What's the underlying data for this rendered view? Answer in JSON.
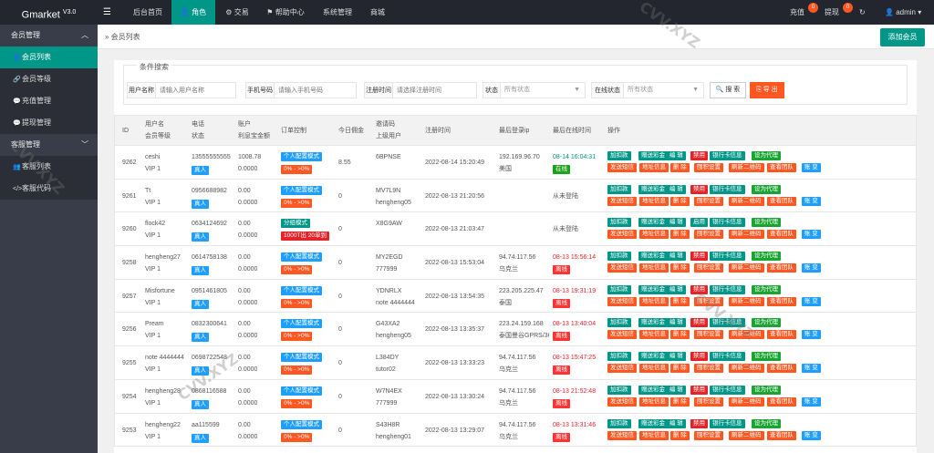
{
  "app": {
    "brand": "Gmarket",
    "version": "V3.0"
  },
  "topnav": [
    "后台首页",
    "角色",
    "交易",
    "帮助中心",
    "系统管理",
    "商城"
  ],
  "topright": {
    "recharge": "充值",
    "recharge_badge": "0",
    "withdraw": "提现",
    "withdraw_badge": "0",
    "user": "admin"
  },
  "sidebar": {
    "group1": "会员管理",
    "items1": [
      "会员列表",
      "会员等级",
      "充值管理",
      "提现管理"
    ],
    "group2": "客服管理",
    "items2": [
      "客服列表",
      "客服代码"
    ]
  },
  "crumb": "会员列表",
  "add_button": "添加会员",
  "filters": {
    "legend": "条件搜索",
    "username_label": "用户名称",
    "username_ph": "请输入用户名称",
    "phone_label": "手机号码",
    "phone_ph": "请输入手机号码",
    "regtime_label": "注册时间",
    "regtime_ph": "请选择注册时间",
    "status_label": "状态",
    "status_value": "所有状态",
    "online_label": "在线状态",
    "online_value": "所有状态",
    "search_btn": "搜 索",
    "export_btn": "导 出"
  },
  "headers": {
    "id": "ID",
    "user1": "用户名",
    "user2": "会员等级",
    "phone1": "电话",
    "phone2": "状态",
    "balance1": "账户",
    "balance2": "利息宝金额",
    "order": "订单控制",
    "today": "今日佣金",
    "invite1": "邀请码",
    "invite2": "上级用户",
    "regtime": "注册时间",
    "lastip": "最后登录ip",
    "lastonline": "最后在线时间",
    "ops": "操作"
  },
  "rows": [
    {
      "id": "9262",
      "user": "ceshi",
      "level": "VIP 1",
      "phone": "13555555555",
      "real": "真人",
      "bal": "1008.78",
      "lixi": "0.0000",
      "mode": "个人配置模式",
      "range": "0% - >0%",
      "range_color": "red",
      "today": "8.55",
      "code": "6BPNSE",
      "parent": "",
      "reg": "2022-08-14 15:20:49",
      "ip": "192.169.96.70",
      "loc": "美国",
      "last": "08-14 16:04:31",
      "last_color": "green",
      "online": "在线",
      "online_state": "on",
      "ban": "禁用"
    },
    {
      "id": "9261",
      "user": "Tt",
      "level": "VIP 1",
      "phone": "0956688982",
      "real": "真人",
      "bal": "0.00",
      "lixi": "0.0000",
      "mode": "个人配置模式",
      "range": "0% - >0%",
      "range_color": "red",
      "today": "0",
      "code": "MV7L9N",
      "parent": "hengheng05",
      "reg": "2022-08-13 21:20:56",
      "ip": "",
      "loc": "",
      "last": "从未登陆",
      "last_color": "gray",
      "online": "",
      "online_state": "",
      "ban": "禁用"
    },
    {
      "id": "9260",
      "user": "flock42",
      "level": "VIP 1",
      "phone": "0634124692",
      "real": "真人",
      "bal": "0.00",
      "lixi": "0.0000",
      "mode": "分组模式",
      "range": "1000T出 20单到",
      "range_color": "dred",
      "today": "0",
      "code": "X8G9AW",
      "parent": "",
      "reg": "2022-08-13 21:03:47",
      "ip": "",
      "loc": "",
      "last": "从未登陆",
      "last_color": "gray",
      "online": "",
      "online_state": "",
      "ban": "启用"
    },
    {
      "id": "9258",
      "user": "hengheng27",
      "level": "VIP 1",
      "phone": "0614758138",
      "real": "真人",
      "bal": "0.00",
      "lixi": "0.0000",
      "mode": "个人配置模式",
      "range": "0% - >0%",
      "range_color": "red",
      "today": "0",
      "code": "MY2EGD",
      "parent": "777999",
      "reg": "2022-08-13 15:53:04",
      "ip": "94.74.117.56",
      "loc": "乌克兰",
      "last": "08-13 15:56:14",
      "last_color": "red",
      "online": "离线",
      "online_state": "off",
      "ban": "禁用"
    },
    {
      "id": "9257",
      "user": "Misfortune",
      "level": "VIP 1",
      "phone": "0951461805",
      "real": "真人",
      "bal": "0.00",
      "lixi": "0.0000",
      "mode": "个人配置模式",
      "range": "0% - >0%",
      "range_color": "red",
      "today": "0",
      "code": "YDNRLX",
      "parent": "note 4444444",
      "reg": "2022-08-13 13:54:35",
      "ip": "223.205.225.47",
      "loc": "泰国",
      "last": "08-13 19:31:19",
      "last_color": "red",
      "online": "离线",
      "online_state": "off",
      "ban": "禁用"
    },
    {
      "id": "9256",
      "user": "Pream",
      "level": "VIP 1",
      "phone": "0832300641",
      "real": "真人",
      "bal": "0.00",
      "lixi": "0.0000",
      "mode": "个人配置模式",
      "range": "0% - >0%",
      "range_color": "red",
      "today": "0",
      "code": "G43XA2",
      "parent": "hengheng05",
      "reg": "2022-08-13 13:35:37",
      "ip": "223.24.159.168",
      "loc": "泰国曼谷GPRS/3G",
      "last": "08-13 13:40:04",
      "last_color": "red",
      "online": "离线",
      "online_state": "off",
      "ban": "禁用"
    },
    {
      "id": "9255",
      "user": "note 4444444",
      "level": "VIP 1",
      "phone": "0698722548",
      "real": "真人",
      "bal": "0.00",
      "lixi": "0.0000",
      "mode": "个人配置模式",
      "range": "0% - >0%",
      "range_color": "red",
      "today": "0",
      "code": "L384DY",
      "parent": "tutor02",
      "reg": "2022-08-13 13:33:23",
      "ip": "94.74.117.56",
      "loc": "乌克兰",
      "last": "08-13 15:47:25",
      "last_color": "red",
      "online": "离线",
      "online_state": "off",
      "ban": "禁用"
    },
    {
      "id": "9254",
      "user": "hengheng28",
      "level": "VIP 1",
      "phone": "0868116588",
      "real": "真人",
      "bal": "0.00",
      "lixi": "0.0000",
      "mode": "个人配置模式",
      "range": "0% - >0%",
      "range_color": "red",
      "today": "0",
      "code": "W7N4EX",
      "parent": "777999",
      "reg": "2022-08-13 13:30:24",
      "ip": "94.74.117.56",
      "loc": "乌克兰",
      "last": "08-13 21:52:48",
      "last_color": "red",
      "online": "离线",
      "online_state": "off",
      "ban": "禁用"
    },
    {
      "id": "9253",
      "user": "hengheng22",
      "level": "VIP 1",
      "phone": "aa115599",
      "real": "真人",
      "bal": "0.00",
      "lixi": "0.0000",
      "mode": "个人配置模式",
      "range": "0% - >0%",
      "range_color": "red",
      "today": "0",
      "code": "S43H8R",
      "parent": "hengheng01",
      "reg": "2022-08-13 13:29:07",
      "ip": "94.74.117.56",
      "loc": "乌克兰",
      "last": "08-13 13:31:46",
      "last_color": "red",
      "online": "离线",
      "online_state": "off",
      "ban": "禁用"
    }
  ],
  "ops": {
    "addsub": "加扣款",
    "gift": "赠送彩金",
    "edit": "编 辑",
    "bank": "银行卡信息",
    "setagent": "设为代理",
    "sms": "发送短信",
    "address": "地址信息",
    "del": "删 除",
    "hoard": "囤积设置",
    "qr": "刷新二维码",
    "team": "查看团队",
    "account": "账 变"
  },
  "watermark": "CVV.XYZ",
  "colors": {
    "brand_green": "#009688",
    "orange": "#ff5722",
    "blue": "#1e9fff",
    "dark": "#23262e",
    "sidebar": "#393d49"
  }
}
